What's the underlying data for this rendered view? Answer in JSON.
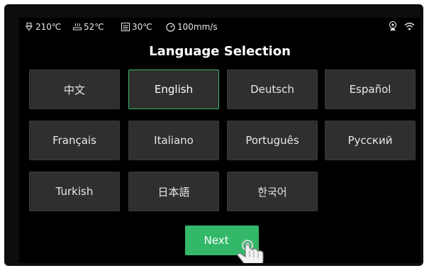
{
  "status_bar": {
    "nozzle_temp": "210℃",
    "bed_temp": "52℃",
    "chamber_temp": "30℃",
    "print_speed": "100mm/s",
    "icons": [
      "nozzle-icon",
      "bed-icon",
      "chamber-icon",
      "speed-icon",
      "camera-icon",
      "wifi-icon"
    ]
  },
  "page": {
    "title": "Language Selection"
  },
  "languages": [
    {
      "label": "中文",
      "selected": false
    },
    {
      "label": "English",
      "selected": true
    },
    {
      "label": "Deutsch",
      "selected": false
    },
    {
      "label": "Español",
      "selected": false
    },
    {
      "label": "Français",
      "selected": false
    },
    {
      "label": "Italiano",
      "selected": false
    },
    {
      "label": "Português",
      "selected": false
    },
    {
      "label": "Русский",
      "selected": false
    },
    {
      "label": "Turkish",
      "selected": false
    },
    {
      "label": "日本語",
      "selected": false
    },
    {
      "label": "한국어",
      "selected": false
    }
  ],
  "actions": {
    "next_label": "Next"
  },
  "colors": {
    "accent": "#33b86a",
    "selected_border": "#35b76b",
    "button_bg": "#2f2f2f",
    "screen_bg": "#000000"
  }
}
